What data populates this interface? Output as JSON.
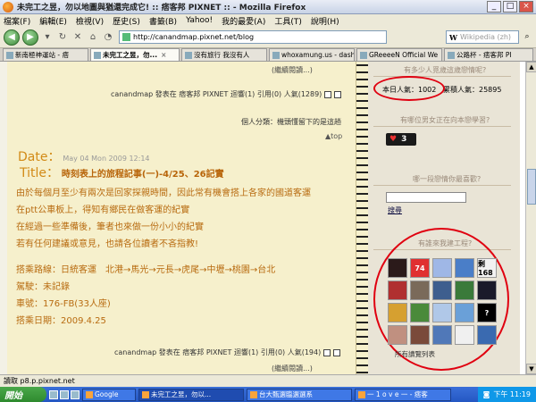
{
  "window": {
    "title": "未完工之昱，勿以地圖與猶還完成它! :: 痞客邦 PIXNET :: - Mozilla Firefox"
  },
  "menu": [
    "檔案(F)",
    "編輯(E)",
    "檢視(V)",
    "歷史(S)",
    "書籤(B)",
    "Yahoo!",
    "我的最愛(A)",
    "工具(T)",
    "說明(H)"
  ],
  "nav": {
    "url": "http://canandmap.pixnet.net/blog",
    "search_placeholder": "Wikipedia (zh)"
  },
  "tabs": [
    {
      "label": "新南極神運站 - 痞"
    },
    {
      "label": "未完工之昱，勿..."
    },
    {
      "label": "沒有旅行 我沒有人"
    },
    {
      "label": "whoxamung.us - dash"
    },
    {
      "label": "GReeeeN Official We"
    },
    {
      "label": "公路杯 - 痞客邦 PI"
    }
  ],
  "post_top": {
    "more": "(繼續閱讀...)",
    "meta": "canandmap 發表在 痞客邦 PIXNET 迴響(1) 引用(0) 人氣(1289)",
    "category": "個人分類：機頭懂留下的是這趟",
    "top": "▲top"
  },
  "post": {
    "date_label": "Date：",
    "date": "May 04 Mon 2009 12:14",
    "title_label": "Title：",
    "title": "時刻表上的旅程記事(一)-4/25、26記實",
    "lines": [
      "由於每個月至少有兩次是回家探親時間，因此常有機會搭上各家的國道客運",
      "在ptt公車板上，得知有鄉民在做客運的紀實",
      "在經過一些準備後，筆者也來做一份小小的紀實",
      "若有任何建議或意見，也請各位讀者不吝指教!",
      "",
      "搭乘路線：日統客運　北港→馬光→元長→虎尾→中壢→桃園→台北",
      "駕駛：未記錄",
      "車號：176-FB(33人座)",
      "搭乘日期：2009.4.25"
    ],
    "meta": "canandmap 發表在 痞客邦 PIXNET 迴響(1) 引用(0) 人氣(194)",
    "more": "(繼續閱讀...)"
  },
  "sidebar": {
    "visitors_head": "有多少人覓歲這歲戀情呢?",
    "today": "本日人氣：1002",
    "total": "累積人氣：25895",
    "online_head": "有哪位男女正在向本戀學習?",
    "online_count": "3",
    "poll_head": "哪一段戀情你最喜歡?",
    "search_label": "搜尋",
    "friends_head": "有誰來我建工程?",
    "avatars": [
      "",
      "74",
      "",
      "",
      "剩168",
      "",
      "",
      "",
      "",
      "",
      "",
      "",
      "",
      "",
      "?",
      "",
      "",
      "",
      "",
      ""
    ],
    "avatar_colors": [
      "#2b1a1a",
      "#e03030",
      "#9fb7e6",
      "#4a7ec8",
      "#f2f2f2",
      "#b03030",
      "#7a6a5a",
      "#3e5e8e",
      "#3a7a3a",
      "#1a1a2a",
      "#d6a030",
      "#4a8a3a",
      "#b0c8e8",
      "#6aa0d8",
      "#000000",
      "#c09080",
      "#7a4a3a",
      "#5078b8",
      "#f0f0f0",
      "#3a6ab0"
    ],
    "all_list": "所有讀覽列表"
  },
  "statusbar": {
    "text": "讀取 p8.p.pixnet.net"
  },
  "taskbar": {
    "start": "開始",
    "tasks": [
      "Google",
      "未完工之昱，勿以...",
      "台大甄選臨選選系",
      "一 1 o v e 一 - 痞客"
    ],
    "clock": "下午 11:19"
  }
}
